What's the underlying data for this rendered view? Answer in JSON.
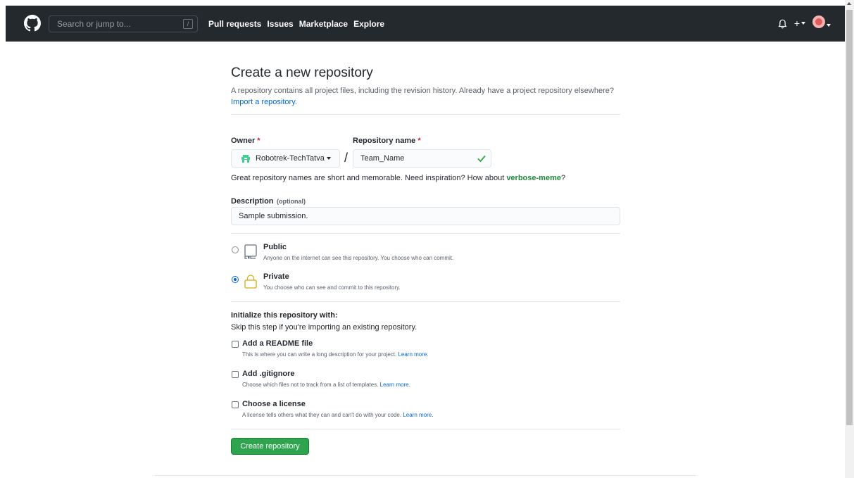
{
  "header": {
    "search_placeholder": "Search or jump to...",
    "search_shortcut": "/",
    "nav": [
      "Pull requests",
      "Issues",
      "Marketplace",
      "Explore"
    ],
    "plus": "+"
  },
  "page": {
    "title": "Create a new repository",
    "subtitle": "A repository contains all project files, including the revision history. Already have a project repository elsewhere?",
    "import_link": "Import a repository."
  },
  "owner": {
    "label": "Owner",
    "required": "*",
    "value": "Robotrek-TechTatva"
  },
  "repo": {
    "label": "Repository name",
    "required": "*",
    "value": "Team_Name",
    "slash": "/"
  },
  "hint": {
    "text": "Great repository names are short and memorable. Need inspiration? How about ",
    "suggestion": "verbose-meme",
    "end": "?"
  },
  "description": {
    "label": "Description",
    "optional": "(optional)",
    "value": "Sample submission."
  },
  "visibility": {
    "public_title": "Public",
    "public_desc": "Anyone on the internet can see this repository. You choose who can commit.",
    "private_title": "Private",
    "private_desc": "You choose who can see and commit to this repository.",
    "selected": "private"
  },
  "init": {
    "title": "Initialize this repository with:",
    "subtitle": "Skip this step if you're importing an existing repository.",
    "learn_more": "Learn more.",
    "options": [
      {
        "title": "Add a README file",
        "desc": "This is where you can write a long description for your project."
      },
      {
        "title": "Add .gitignore",
        "desc": "Choose which files not to track from a list of templates."
      },
      {
        "title": "Choose a license",
        "desc": "A license tells others what they can and can't do with your code."
      }
    ]
  },
  "submit": {
    "label": "Create repository"
  },
  "colors": {
    "header_bg": "#24292e",
    "primary_button": "#2ea44f",
    "link": "#0366d6",
    "required": "#cb2431"
  },
  "icons": [
    "github-logo-icon",
    "bell-icon",
    "plus-icon",
    "avatar",
    "check-icon",
    "repo-icon",
    "lock-icon",
    "owner-avatar-icon"
  ]
}
